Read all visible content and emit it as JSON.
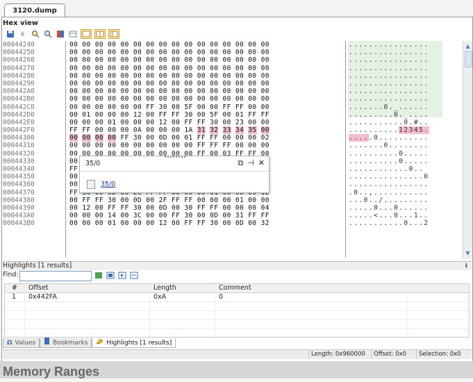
{
  "tab_title": "3120.dump",
  "panel_title": "Hex view",
  "toolbar_icons": [
    "save-icon",
    "back-icon",
    "find-icon",
    "bookmark-icon",
    "columns-icon",
    "layout-icon",
    "view-hex-icon",
    "view-split-icon",
    "view-text-icon"
  ],
  "hex_rows": [
    {
      "offset": "00044240",
      "bytes": "00 00 00 00 00 00 00 00 00 00 00 00 00 00 00 00",
      "ascii": "................"
    },
    {
      "offset": "00044250",
      "bytes": "00 00 00 00 00 00 00 00 00 00 00 00 00 00 00 00",
      "ascii": "................"
    },
    {
      "offset": "00044260",
      "bytes": "00 00 00 00 00 00 00 00 00 00 00 00 00 00 00 00",
      "ascii": "................"
    },
    {
      "offset": "00044270",
      "bytes": "00 00 00 00 00 00 00 00 00 00 00 00 00 00 00 00",
      "ascii": "................"
    },
    {
      "offset": "00044280",
      "bytes": "00 00 00 00 00 00 00 00 00 00 00 00 00 00 00 00",
      "ascii": "................"
    },
    {
      "offset": "00044290",
      "bytes": "00 00 00 00 00 00 00 00 00 00 00 00 00 00 00 00",
      "ascii": "................"
    },
    {
      "offset": "000442A0",
      "bytes": "00 00 00 00 00 00 00 00 00 00 00 00 00 00 00 00",
      "ascii": "................"
    },
    {
      "offset": "000442B0",
      "bytes": "00 00 00 00 00 00 00 00 00 00 00 00 00 00 00 00",
      "ascii": "................"
    },
    {
      "offset": "000442C0",
      "bytes": "00 00 00 00 00 00 FF 30 00 5F 00 00 FF FF 00 00",
      "ascii": ".......0._......"
    },
    {
      "offset": "000442D0",
      "bytes": "00 01 00 00 00 12 00 FF FF 30 00 5F 00 01 FF FF",
      "ascii": ".........0._...."
    },
    {
      "offset": "000442E0",
      "bytes": "00 00 00 01 00 00 00 12 00 FF FF 30 00 23 00 00",
      "ascii": "...........0.#.."
    },
    {
      "offset": "000442F0",
      "bytes": "FF FF 00 00 00 0A 00 00 00 1A 31 32 33 34 35 00",
      "ascii": "..........12345."
    },
    {
      "offset": "00044300",
      "bytes": "00 00 00 00 FF 30 00 0D 00 01 FF FF 00 00 00 02",
      "ascii": ".....0.........."
    },
    {
      "offset": "00044310",
      "bytes": "00 00 00 00 00 00 00 00 00 00 FF FF FF 00 00 00",
      "ascii": ".......0........"
    },
    {
      "offset": "00044320",
      "bytes": "00 00 00 00 00 00 00 00 00 00 FF 00 03 FF FF 00",
      "ascii": "..........0....."
    },
    {
      "offset": "00044330",
      "bytes": "00 00 00 00 00 00 00 00 00 00 00 00 0D 00 0A 00",
      "ascii": "..........0....."
    },
    {
      "offset": "00044340",
      "bytes": "FF 00 00 00 00 00 00 00 00 00 FF FF 30 00 0D 00",
      "ascii": "............0.."
    },
    {
      "offset": "00044350",
      "bytes": "00 0D FF FF 00 00 00 01 00 00 00 12 00 FF FF 30",
      "ascii": "...............0"
    },
    {
      "offset": "00044360",
      "bytes": "00 0D 00 00 0E FF FF 00 00 01 00 00 00 12 00 FF",
      "ascii": "................"
    },
    {
      "offset": "00044370",
      "bytes": "FF 30 00 0D 00 2C FF FF 00 00 00 01 00 00 00 12",
      "ascii": ".0..,..........."
    },
    {
      "offset": "00044380",
      "bytes": "00 FF FF 30 00 0D 00 2F FF FF 00 00 00 01 00 00",
      "ascii": "...0../........."
    },
    {
      "offset": "00044390",
      "bytes": "00 12 00 FF FF 30 00 0D 00 30 FF FF 00 00 00 04",
      "ascii": ".....0...0......"
    },
    {
      "offset": "000443A0",
      "bytes": "00 00 00 14 00 3C 00 00 FF 30 00 0D 00 31 FF FF",
      "ascii": ".....<...0...1.."
    },
    {
      "offset": "000443B0",
      "bytes": "00 00 00 01 00 00 00 12 00 FF FF 30 00 0D 00 32",
      "ascii": "...........0...2"
    }
  ],
  "popup": {
    "title": "35/0",
    "link_text": "35/0"
  },
  "highlights_title": "Highlights [1 results]",
  "find_label": "Find:",
  "table": {
    "headers": [
      "#",
      "Offset",
      "Length",
      "Comment"
    ],
    "rows": [
      {
        "num": "1",
        "offset": "0x442FA",
        "length": "0xA",
        "comment": "0"
      }
    ]
  },
  "bottom_tabs": [
    {
      "label": "Values",
      "icon": "omega-icon"
    },
    {
      "label": "Bookmarks",
      "icon": "bookmark-icon"
    },
    {
      "label": "Highlights [1 results]",
      "icon": "highlighter-icon"
    }
  ],
  "status": {
    "length": "Length: 0x960000",
    "offset": "Offset: 0x0",
    "selection": "Selection: 0x0"
  },
  "caption": "Memory Ranges",
  "colors": {
    "highlight": "#f3bcd0",
    "green_tint": "#e4f2e4",
    "caption_bg": "#d6d6d6"
  }
}
